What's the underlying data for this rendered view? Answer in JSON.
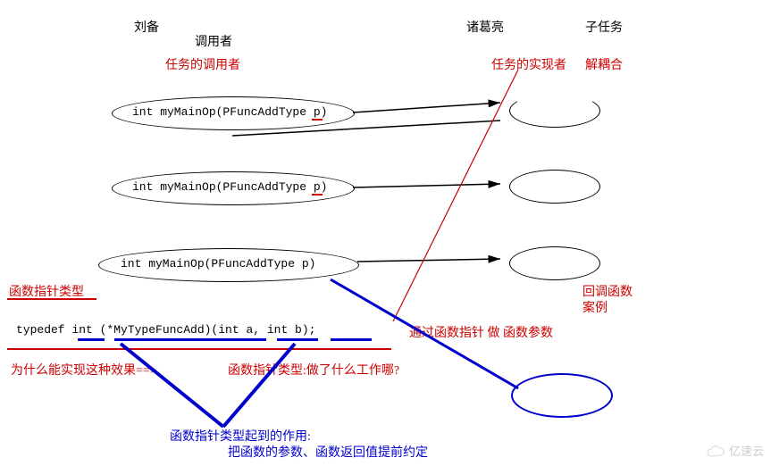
{
  "headers": {
    "liu_bei": "刘备",
    "caller": "调用者",
    "zhuge_liang": "诸葛亮",
    "subtask": "子任务"
  },
  "red_labels": {
    "task_caller": "任务的调用者",
    "task_implementer": "任务的实现者",
    "decoupling": "解耦合",
    "callback_line1": "回调函数",
    "callback_line2": "案例",
    "why_effect": "为什么能实现这种效果==>",
    "fp_type_what": "函数指针类型:做了什么工作哪?",
    "fp_type_label": "函数指针类型",
    "via_fp": "通过函数指针  做 函数参数"
  },
  "func_signature": "int myMainOp(PFuncAddType p)",
  "typedef_line": "typedef int (*MyTypeFuncAdd)(int a, int b);",
  "blue_labels": {
    "role_line1": "函数指针类型起到的作用:",
    "role_line2": "把函数的参数、函数返回值提前约定"
  },
  "watermark": "亿速云"
}
